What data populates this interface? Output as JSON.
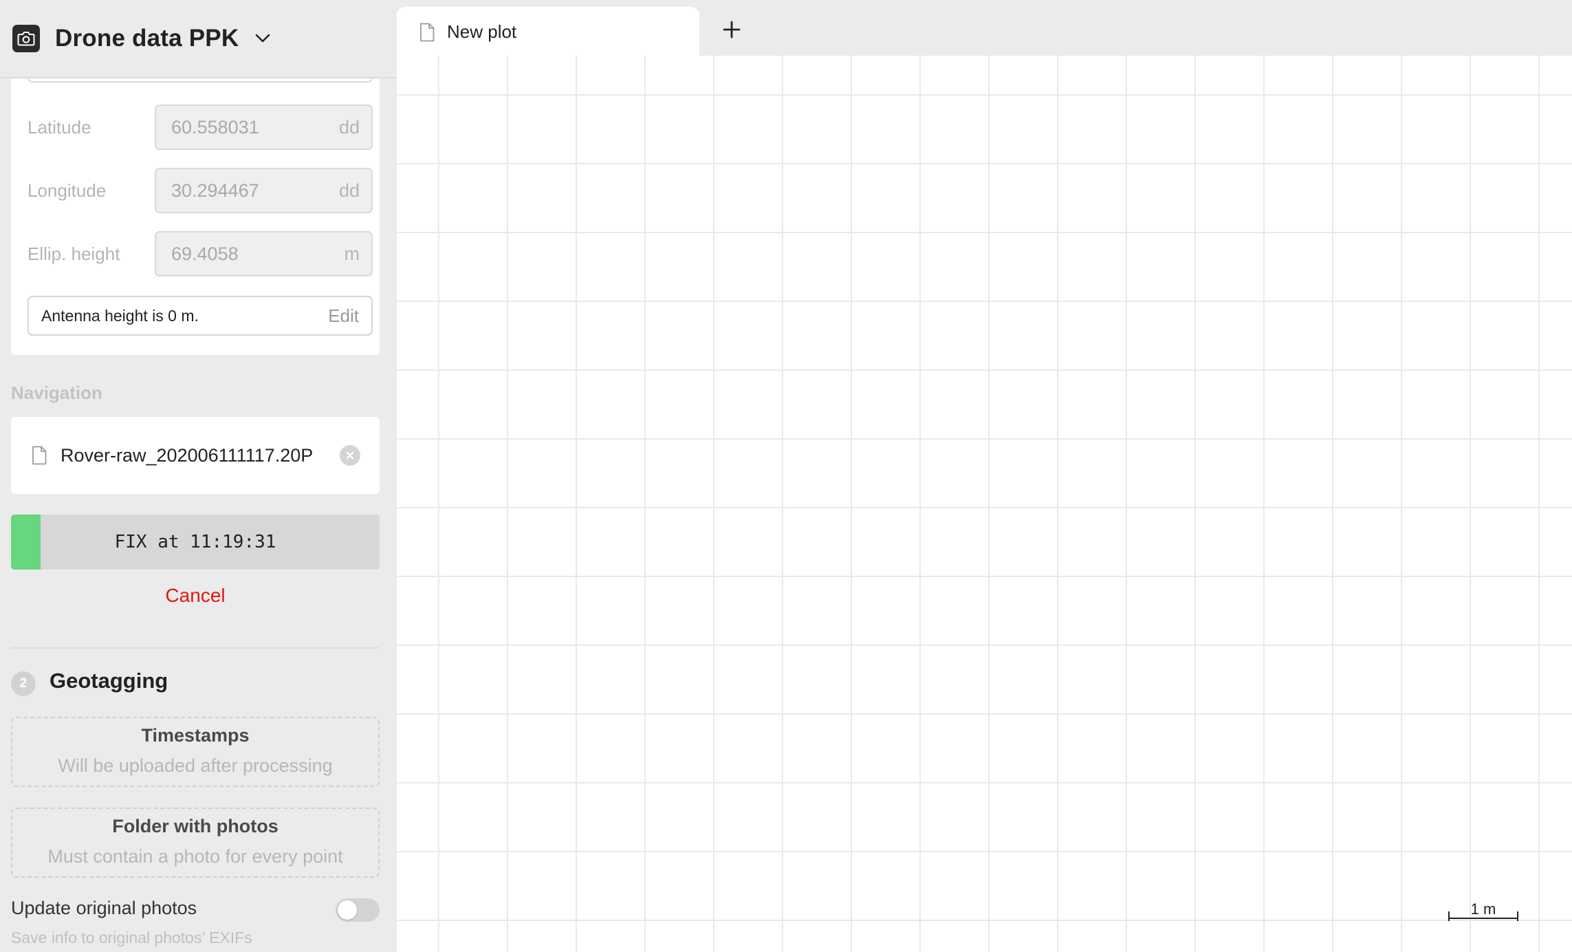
{
  "header": {
    "title": "Drone data PPK",
    "app_icon": "camera-icon",
    "chevron_icon": "chevron-down-icon"
  },
  "base_station": {
    "fields": [
      {
        "label": "Latitude",
        "value": "60.558031",
        "unit": "dd"
      },
      {
        "label": "Longitude",
        "value": "30.294467",
        "unit": "dd"
      },
      {
        "label": "Ellip. height",
        "value": "69.4058",
        "unit": "m"
      }
    ],
    "antenna": {
      "text": "Antenna height is 0 m.",
      "edit_label": "Edit"
    }
  },
  "navigation": {
    "section_label": "Navigation",
    "file_icon": "file-icon",
    "file_name": "Rover-raw_202006111117.20P",
    "remove_icon": "close-circle-icon"
  },
  "processing": {
    "status_text": "FIX at 11:19:31",
    "progress_percent": 8,
    "fill_color": "#67d67f",
    "cancel_label": "Cancel",
    "cancel_color": "#e81414"
  },
  "geotagging": {
    "step_number": "2",
    "title": "Geotagging",
    "timestamps": {
      "title": "Timestamps",
      "subtitle": "Will be uploaded after processing"
    },
    "photos_folder": {
      "title": "Folder with photos",
      "subtitle": "Must contain a photo for every point"
    },
    "update_photos": {
      "label": "Update original photos",
      "sublabel": "Save info to original photos’ EXIFs",
      "enabled": false
    }
  },
  "tabs": [
    {
      "label": "New plot",
      "icon": "file-icon"
    }
  ],
  "add_tab_icon": "plus-icon",
  "map": {
    "scale_label": "1 m"
  }
}
